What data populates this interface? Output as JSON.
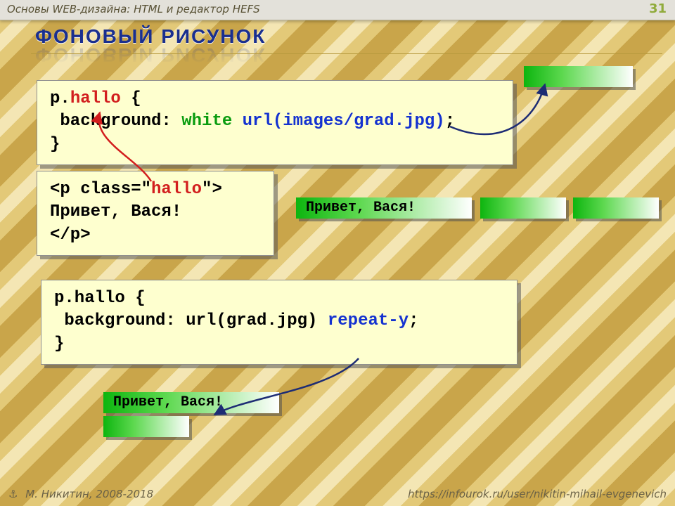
{
  "header": {
    "title": "Основы WEB-дизайна: HTML и редактор HEFS",
    "page_number": "31"
  },
  "heading": "ФОНОВЫЙ РИСУНОК",
  "code1": {
    "line1a": "p.",
    "line1b": "hallo",
    "line1c": " {",
    "line2a": " background: ",
    "line2b": "white",
    "line2c": " ",
    "line2d": "url(images/grad.jpg)",
    "line2e": ";",
    "line3": "}"
  },
  "code2": {
    "line1a": "<p class=\"",
    "line1b": "hallo",
    "line1c": "\">",
    "line2": "Привет, Вася!",
    "line3": "</p>"
  },
  "code3": {
    "line1": "p.hallo {",
    "line2a": " background: url(grad.jpg) ",
    "line2b": "repeat-y",
    "line2c": ";",
    "line3": "}"
  },
  "samples": {
    "greeting": "Привет, Вася!"
  },
  "footer": {
    "anchor": "⚓",
    "author": "М. Никитин, 2008-2018",
    "url": "https://infourok.ru/user/nikitin-mihail-evgenevich"
  }
}
